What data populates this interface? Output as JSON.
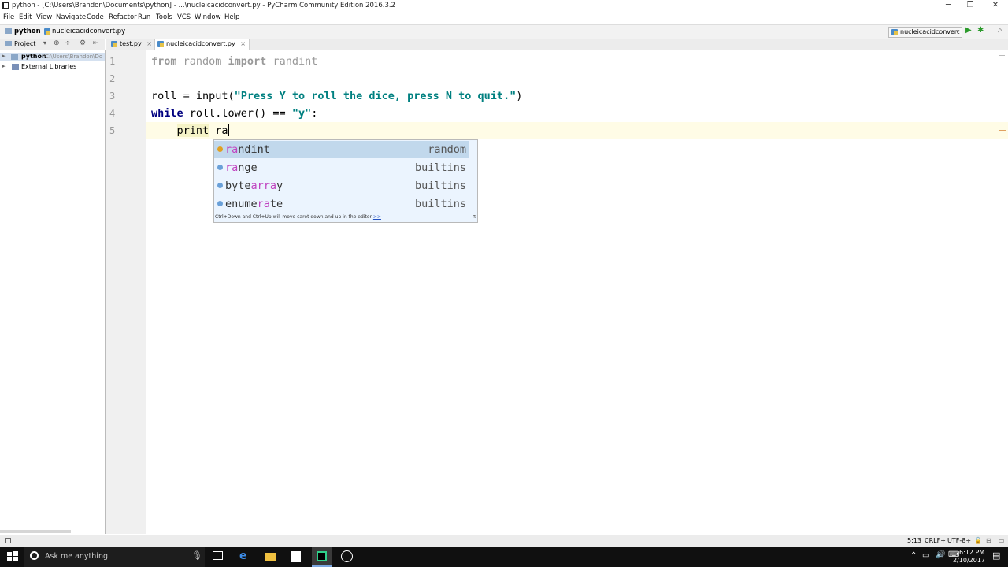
{
  "window": {
    "title": "python - [C:\\Users\\Brandon\\Documents\\python] - ...\\nucleicacidconvert.py - PyCharm Community Edition 2016.3.2",
    "minimize": "─",
    "restore": "❐",
    "close": "✕"
  },
  "menu": [
    "File",
    "Edit",
    "View",
    "Navigate",
    "Code",
    "Refactor",
    "Run",
    "Tools",
    "VCS",
    "Window",
    "Help"
  ],
  "breadcrumb": {
    "project": "python",
    "file": "nucleicacidconvert.py"
  },
  "run_config": {
    "label": "nucleicacidconvert"
  },
  "project_panel": {
    "title": "Project"
  },
  "tabs": [
    {
      "label": "test.py",
      "close": "×"
    },
    {
      "label": "nucleicacidconvert.py",
      "close": "×"
    }
  ],
  "tree": {
    "root_label": "python",
    "root_path": "C:\\Users\\Brandon\\Do",
    "libs": "External Libraries"
  },
  "editor": {
    "line_numbers": [
      "1",
      "2",
      "3",
      "4",
      "5"
    ],
    "line1": {
      "kw1": "from",
      "mod": " random ",
      "kw2": "import",
      "name": " randint"
    },
    "line3": {
      "pre": "roll = input(",
      "str": "\"Press Y to roll the dice, press N to quit.\"",
      "post": ")"
    },
    "line4": {
      "kw": "while",
      "pre": " roll.lower() == ",
      "str": "\"y\"",
      "post": ":"
    },
    "line5": {
      "indent": "    ",
      "print": "print",
      "typed": " ra"
    }
  },
  "completion": {
    "items": [
      {
        "pre": "",
        "match": "ra",
        "post": "ndint",
        "module": "random",
        "icon_color": "#e0a020"
      },
      {
        "pre": "",
        "match": "ra",
        "post": "nge",
        "module": "builtins",
        "icon_color": "#6aa0d8"
      },
      {
        "pre": "byte",
        "match": "arra",
        "post": "y",
        "module": "builtins",
        "icon_color": "#6aa0d8"
      },
      {
        "pre": "enume",
        "match": "ra",
        "post": "te",
        "module": "builtins",
        "icon_color": "#6aa0d8"
      }
    ],
    "hint": "Ctrl+Down and Ctrl+Up will move caret down and up in the editor",
    "hint_more": ">>",
    "pi": "π"
  },
  "status": {
    "position": "5:13",
    "line_sep": "CRLF÷",
    "encoding": "UTF-8÷"
  },
  "taskbar": {
    "search_placeholder": "Ask me anything",
    "time": "6:12 PM",
    "date": "2/10/2017"
  }
}
